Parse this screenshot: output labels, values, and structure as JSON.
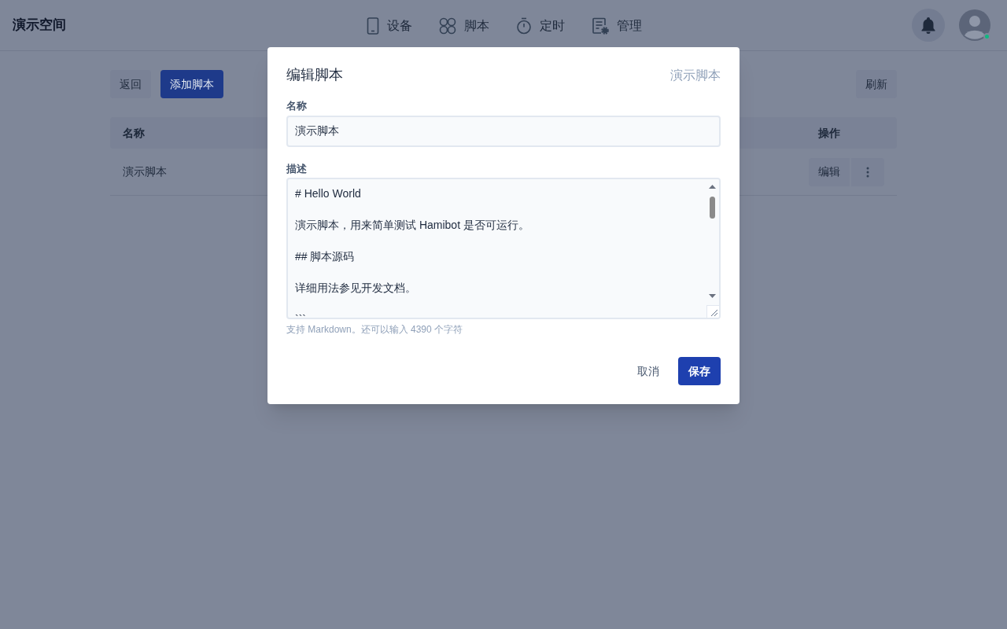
{
  "header": {
    "workspace": "演示空间",
    "nav": [
      {
        "label": "设备",
        "kind": "phone"
      },
      {
        "label": "脚本",
        "kind": "clover"
      },
      {
        "label": "定时",
        "kind": "timer"
      },
      {
        "label": "管理",
        "kind": "manage"
      }
    ],
    "user_online": true
  },
  "toolbar": {
    "back": "返回",
    "add": "添加脚本",
    "refresh": "刷新"
  },
  "table": {
    "columns": [
      "名称",
      "操作"
    ],
    "rows": [
      {
        "name": "演示脚本",
        "edit": "编辑"
      }
    ]
  },
  "dialog": {
    "title": "编辑脚本",
    "subtitle": "演示脚本",
    "name_label": "名称",
    "name_value": "演示脚本",
    "desc_label": "描述",
    "desc_lines": [
      "# Hello World",
      "演示脚本，用来简单测试 Hamibot 是否可运行。",
      "## 脚本源码",
      "详细用法参见开发文档。",
      "```"
    ],
    "hint": "支持 Markdown。还可以输入 4390 个字符",
    "cancel": "取消",
    "save": "保存"
  }
}
